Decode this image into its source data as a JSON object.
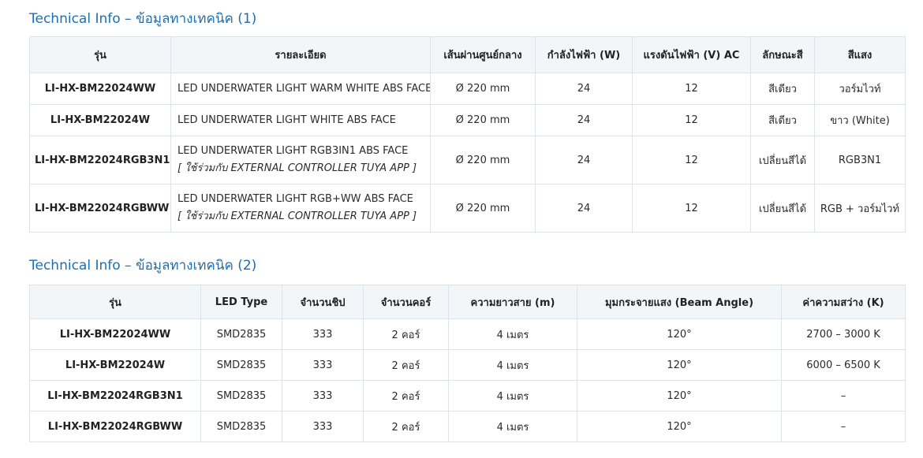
{
  "section1": {
    "title": "Technical Info – ข้อมูลทางเทคนิค (1)",
    "headers": [
      "รุ่น",
      "รายละเอียด",
      "เส้นผ่านศูนย์กลาง",
      "กำลังไฟฟ้า (W)",
      "แรงดันไฟฟ้า (V) AC",
      "ลักษณะสี",
      "สีแสง"
    ],
    "rows": [
      {
        "model": "LI-HX-BM22024WW",
        "desc": "LED UNDERWATER LIGHT WARM WHITE ABS FACE",
        "note": "",
        "diameter": "Ø 220 mm",
        "power": "24",
        "voltage": "12",
        "color_type": "สีเดียว",
        "light_color": "วอร์มไวท์"
      },
      {
        "model": "LI-HX-BM22024W",
        "desc": "LED UNDERWATER LIGHT WHITE ABS FACE",
        "note": "",
        "diameter": "Ø 220 mm",
        "power": "24",
        "voltage": "12",
        "color_type": "สีเดียว",
        "light_color": "ขาว (White)"
      },
      {
        "model": "LI-HX-BM22024RGB3N1",
        "desc": "LED UNDERWATER LIGHT RGB3IN1 ABS FACE",
        "note": "[ ใช้ร่วมกับ EXTERNAL CONTROLLER TUYA APP ]",
        "diameter": "Ø 220 mm",
        "power": "24",
        "voltage": "12",
        "color_type": "เปลี่ยนสีได้",
        "light_color": "RGB3N1"
      },
      {
        "model": "LI-HX-BM22024RGBWW",
        "desc": "LED UNDERWATER LIGHT RGB+WW ABS FACE",
        "note": "[ ใช้ร่วมกับ EXTERNAL CONTROLLER TUYA APP ]",
        "diameter": "Ø 220 mm",
        "power": "24",
        "voltage": "12",
        "color_type": "เปลี่ยนสีได้",
        "light_color": "RGB + วอร์มไวท์"
      }
    ]
  },
  "section2": {
    "title": "Technical Info – ข้อมูลทางเทคนิค (2)",
    "headers": [
      "รุ่น",
      "LED Type",
      "จำนวนชิป",
      "จำนวนคอร์",
      "ความยาวสาย (m)",
      "มุมกระจายแสง (Beam Angle)",
      "ค่าความสว่าง (K)"
    ],
    "rows": [
      {
        "model": "LI-HX-BM22024WW",
        "led_type": "SMD2835",
        "chips": "333",
        "cores": "2 คอร์",
        "cable": "4 เมตร",
        "beam": "120°",
        "kelvin": "2700 – 3000 K"
      },
      {
        "model": "LI-HX-BM22024W",
        "led_type": "SMD2835",
        "chips": "333",
        "cores": "2 คอร์",
        "cable": "4 เมตร",
        "beam": "120°",
        "kelvin": "6000 – 6500 K"
      },
      {
        "model": "LI-HX-BM22024RGB3N1",
        "led_type": "SMD2835",
        "chips": "333",
        "cores": "2 คอร์",
        "cable": "4 เมตร",
        "beam": "120°",
        "kelvin": "–"
      },
      {
        "model": "LI-HX-BM22024RGBWW",
        "led_type": "SMD2835",
        "chips": "333",
        "cores": "2 คอร์",
        "cable": "4 เมตร",
        "beam": "120°",
        "kelvin": "–"
      }
    ]
  },
  "colors": {
    "title": "#1f6fb0",
    "header_bg": "#f3f6f9",
    "border": "#dde3ea"
  }
}
